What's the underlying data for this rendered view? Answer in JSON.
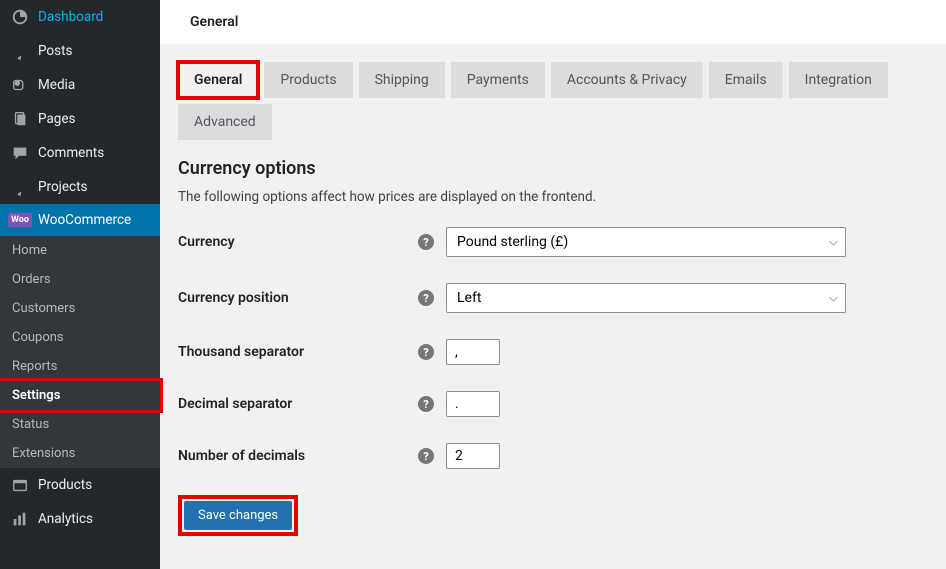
{
  "sidebar": {
    "items": [
      {
        "label": "Dashboard",
        "icon": "dashboard"
      },
      {
        "label": "Posts",
        "icon": "pin"
      },
      {
        "label": "Media",
        "icon": "media"
      },
      {
        "label": "Pages",
        "icon": "pages"
      },
      {
        "label": "Comments",
        "icon": "comment"
      },
      {
        "label": "Projects",
        "icon": "pin"
      },
      {
        "label": "WooCommerce",
        "icon": "woo"
      }
    ],
    "woo_sub": [
      {
        "label": "Home"
      },
      {
        "label": "Orders"
      },
      {
        "label": "Customers"
      },
      {
        "label": "Coupons"
      },
      {
        "label": "Reports"
      },
      {
        "label": "Settings"
      },
      {
        "label": "Status"
      },
      {
        "label": "Extensions"
      }
    ],
    "trailing": [
      {
        "label": "Products",
        "icon": "products"
      },
      {
        "label": "Analytics",
        "icon": "analytics"
      }
    ],
    "woo_badge": "Woo"
  },
  "topbar": {
    "title": "General"
  },
  "tabs": [
    {
      "label": "General"
    },
    {
      "label": "Products"
    },
    {
      "label": "Shipping"
    },
    {
      "label": "Payments"
    },
    {
      "label": "Accounts & Privacy"
    },
    {
      "label": "Emails"
    },
    {
      "label": "Integration"
    },
    {
      "label": "Advanced"
    }
  ],
  "section": {
    "heading": "Currency options",
    "description": "The following options affect how prices are displayed on the frontend."
  },
  "fields": {
    "currency": {
      "label": "Currency",
      "value": "Pound sterling (£)"
    },
    "currency_position": {
      "label": "Currency position",
      "value": "Left"
    },
    "thousand_sep": {
      "label": "Thousand separator",
      "value": ","
    },
    "decimal_sep": {
      "label": "Decimal separator",
      "value": "."
    },
    "num_decimals": {
      "label": "Number of decimals",
      "value": "2"
    }
  },
  "buttons": {
    "save": "Save changes"
  }
}
